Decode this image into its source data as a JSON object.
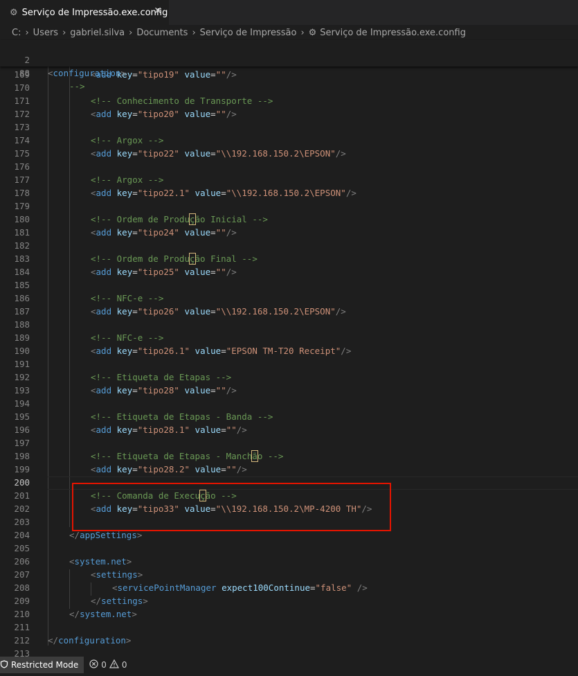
{
  "tab": {
    "icon": "gear-icon",
    "title": "Serviço de Impressão.exe.config",
    "close": "✕"
  },
  "breadcrumb": {
    "drive": "C:",
    "parts": [
      "Users",
      "gabriel.silva",
      "Documents",
      "Serviço de Impressão"
    ],
    "file": "Serviço de Impressão.exe.config",
    "separator": "›"
  },
  "sticky": {
    "l1": {
      "num": "2",
      "open": "<",
      "tag": "configuration",
      "close": ">"
    },
    "l2": {
      "num": "88",
      "text": "-->"
    }
  },
  "code": {
    "l169": {
      "num": "169",
      "o": "<",
      "tag": "add",
      "k": "key",
      "eq": "=",
      "kv": "\"tipo19\"",
      "v": "value",
      "vv": "\"\"",
      "c": "/>"
    },
    "l170": {
      "num": "170"
    },
    "l171": {
      "num": "171",
      "comment": "<!-- Conhecimento de Transporte -->"
    },
    "l172": {
      "num": "172",
      "o": "<",
      "tag": "add",
      "k": "key",
      "eq": "=",
      "kv": "\"tipo20\"",
      "v": "value",
      "vv": "\"\"",
      "c": "/>"
    },
    "l173": {
      "num": "173"
    },
    "l174": {
      "num": "174",
      "comment": "<!-- Argox -->"
    },
    "l175": {
      "num": "175",
      "o": "<",
      "tag": "add",
      "k": "key",
      "eq": "=",
      "kv": "\"tipo22\"",
      "v": "value",
      "vv": "\"\\\\192.168.150.2\\EPSON\"",
      "c": "/>"
    },
    "l176": {
      "num": "176"
    },
    "l177": {
      "num": "177",
      "comment": "<!-- Argox -->"
    },
    "l178": {
      "num": "178",
      "o": "<",
      "tag": "add",
      "k": "key",
      "eq": "=",
      "kv": "\"tipo22.1\"",
      "v": "value",
      "vv": "\"\\\\192.168.150.2\\EPSON\"",
      "c": "/>"
    },
    "l179": {
      "num": "179"
    },
    "l180": {
      "num": "180",
      "c1": "<!-- Ordem de Produ",
      "ch": "ç",
      "c2": "ão Inicial -->"
    },
    "l181": {
      "num": "181",
      "o": "<",
      "tag": "add",
      "k": "key",
      "eq": "=",
      "kv": "\"tipo24\"",
      "v": "value",
      "vv": "\"\"",
      "c": "/>"
    },
    "l182": {
      "num": "182"
    },
    "l183": {
      "num": "183",
      "c1": "<!-- Ordem de Produ",
      "ch": "ç",
      "c2": "ão Final -->"
    },
    "l184": {
      "num": "184",
      "o": "<",
      "tag": "add",
      "k": "key",
      "eq": "=",
      "kv": "\"tipo25\"",
      "v": "value",
      "vv": "\"\"",
      "c": "/>"
    },
    "l185": {
      "num": "185"
    },
    "l186": {
      "num": "186",
      "comment": "<!-- NFC-e -->"
    },
    "l187": {
      "num": "187",
      "o": "<",
      "tag": "add",
      "k": "key",
      "eq": "=",
      "kv": "\"tipo26\"",
      "v": "value",
      "vv": "\"\\\\192.168.150.2\\EPSON\"",
      "c": "/>"
    },
    "l188": {
      "num": "188"
    },
    "l189": {
      "num": "189",
      "comment": "<!-- NFC-e -->"
    },
    "l190": {
      "num": "190",
      "o": "<",
      "tag": "add",
      "k": "key",
      "eq": "=",
      "kv": "\"tipo26.1\"",
      "v": "value",
      "vv": "\"EPSON TM-T20 Receipt\"",
      "c": "/>"
    },
    "l191": {
      "num": "191"
    },
    "l192": {
      "num": "192",
      "comment": "<!-- Etiqueta de Etapas -->"
    },
    "l193": {
      "num": "193",
      "o": "<",
      "tag": "add",
      "k": "key",
      "eq": "=",
      "kv": "\"tipo28\"",
      "v": "value",
      "vv": "\"\"",
      "c": "/>"
    },
    "l194": {
      "num": "194"
    },
    "l195": {
      "num": "195",
      "comment": "<!-- Etiqueta de Etapas - Banda -->"
    },
    "l196": {
      "num": "196",
      "o": "<",
      "tag": "add",
      "k": "key",
      "eq": "=",
      "kv": "\"tipo28.1\"",
      "v": "value",
      "vv": "\"\"",
      "c": "/>"
    },
    "l197": {
      "num": "197"
    },
    "l198": {
      "num": "198",
      "c1": "<!-- Etiqueta de Etapas - Manch",
      "ch": "ã",
      "c2": "o -->"
    },
    "l199": {
      "num": "199",
      "o": "<",
      "tag": "add",
      "k": "key",
      "eq": "=",
      "kv": "\"tipo28.2\"",
      "v": "value",
      "vv": "\"\"",
      "c": "/>"
    },
    "l200": {
      "num": "200"
    },
    "l201": {
      "num": "201",
      "c1": "<!-- Comanda de Execu",
      "ch": "ç",
      "c2": "ão -->"
    },
    "l202": {
      "num": "202",
      "o": "<",
      "tag": "add",
      "k": "key",
      "eq": "=",
      "kv": "\"tipo33\"",
      "v": "value",
      "vv": "\"\\\\192.168.150.2\\MP-4200 TH\"",
      "c": "/>"
    },
    "l203": {
      "num": "203"
    },
    "l204": {
      "num": "204",
      "o": "</",
      "tag": "appSettings",
      "c": ">"
    },
    "l205": {
      "num": "205"
    },
    "l206": {
      "num": "206",
      "o": "<",
      "tag": "system.net",
      "c": ">"
    },
    "l207": {
      "num": "207",
      "o": "<",
      "tag": "settings",
      "c": ">"
    },
    "l208": {
      "num": "208",
      "o": "<",
      "tag": "servicePointManager",
      "a": "expect100Continue",
      "eq": "=",
      "av": "\"false\"",
      "c": " />"
    },
    "l209": {
      "num": "209",
      "o": "</",
      "tag": "settings",
      "c": ">"
    },
    "l210": {
      "num": "210",
      "o": "</",
      "tag": "system.net",
      "c": ">"
    },
    "l211": {
      "num": "211"
    },
    "l212": {
      "num": "212",
      "o": "</",
      "tag": "configuration",
      "c": ">"
    },
    "l213": {
      "num": "213"
    }
  },
  "status": {
    "mode_icon": "restricted-icon",
    "mode": "Restricted Mode",
    "errors_icon": "error-icon",
    "errors": "0",
    "warnings_icon": "warning-icon",
    "warnings": "0"
  },
  "colors": {
    "comment": "#6a9955",
    "tag": "#569cd6",
    "attribute": "#9cdcfe",
    "string": "#ce9178",
    "highlight_box": "#e51400"
  }
}
